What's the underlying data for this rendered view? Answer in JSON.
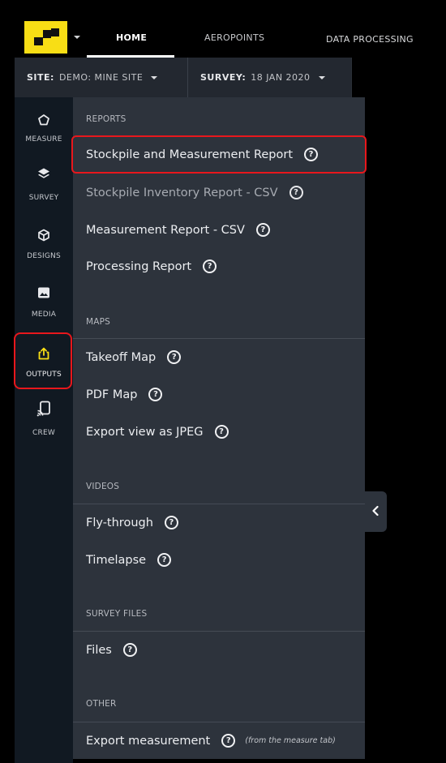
{
  "nav": {
    "tabs": [
      {
        "label": "HOME",
        "active": true
      },
      {
        "label": "AEROPOINTS",
        "active": false
      },
      {
        "label": "DATA PROCESSING",
        "active": false
      }
    ],
    "logo_color": "#f8de15"
  },
  "filters": {
    "site_label": "SITE:",
    "site_value": "DEMO: MINE SITE",
    "survey_label": "SURVEY:",
    "survey_value": "18 JAN 2020"
  },
  "rail": {
    "items": [
      {
        "label": "MEASURE",
        "icon": "pentagon-icon"
      },
      {
        "label": "SURVEY",
        "icon": "layers-icon"
      },
      {
        "label": "DESIGNS",
        "icon": "cube-icon"
      },
      {
        "label": "MEDIA",
        "icon": "image-icon"
      },
      {
        "label": "OUTPUTS",
        "icon": "share-upload-icon",
        "active": true
      },
      {
        "label": "CREW",
        "icon": "cast-device-icon"
      }
    ],
    "active_color": "#f8de15"
  },
  "panel": {
    "sections": [
      {
        "title": "REPORTS",
        "items": [
          {
            "label": "Stockpile and Measurement Report",
            "help": "?"
          },
          {
            "label": "Stockpile Inventory Report - CSV",
            "help": "?",
            "disabled": true
          },
          {
            "label": "Measurement Report - CSV",
            "help": "?"
          },
          {
            "label": "Processing Report",
            "help": "?"
          }
        ]
      },
      {
        "title": "MAPS",
        "items": [
          {
            "label": "Takeoff Map",
            "help": "?"
          },
          {
            "label": "PDF Map",
            "help": "?"
          },
          {
            "label": "Export view as JPEG",
            "help": "?"
          }
        ]
      },
      {
        "title": "VIDEOS",
        "items": [
          {
            "label": "Fly-through",
            "help": "?"
          },
          {
            "label": "Timelapse",
            "help": "?"
          }
        ]
      },
      {
        "title": "SURVEY FILES",
        "items": [
          {
            "label": "Files",
            "help": "?"
          }
        ]
      },
      {
        "title": "OTHER",
        "items": [
          {
            "label": "Export measurement",
            "help": "?",
            "note": "(from the measure tab)"
          }
        ]
      }
    ]
  },
  "colors": {
    "highlight": "#e8171c",
    "panel_bg": "#2d333c",
    "rail_bg": "#111922"
  }
}
